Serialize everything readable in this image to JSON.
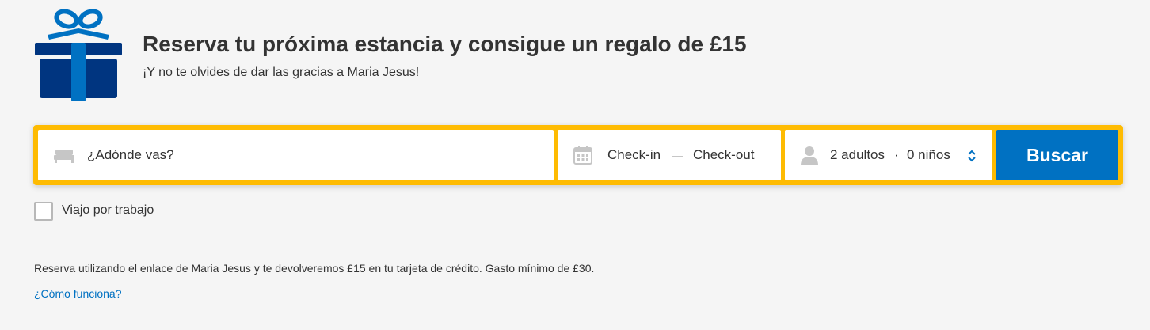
{
  "promo": {
    "headline": "Reserva tu próxima estancia y consigue un regalo de £15",
    "subline": "¡Y no te olvides de dar las gracias a Maria Jesus!",
    "icon": "gift-icon"
  },
  "search": {
    "destination_placeholder": "¿Adónde vas?",
    "destination_icon": "bed-icon",
    "checkin_label": "Check-in",
    "checkout_label": "Check-out",
    "dates_icon": "calendar-icon",
    "guests_icon": "person-icon",
    "adults_label": "2 adultos",
    "dot": "·",
    "children_label": "0 niños",
    "stepper_icon": "chevron-updown-icon",
    "search_button": "Buscar"
  },
  "options": {
    "work_trip_label": "Viajo por trabajo",
    "work_trip_checked": false
  },
  "footer": {
    "info_text": "Reserva utilizando el enlace de Maria Jesus y te devolveremos £15 en tu tarjeta de crédito. Gasto mínimo de £30.",
    "how_link": "¿Cómo funciona?"
  },
  "colors": {
    "background": "#f5f5f5",
    "searchbar_border": "#febb02",
    "button": "#0071c2",
    "gift_dark": "#003580",
    "gift_light": "#0071c2",
    "link": "#0071c2"
  }
}
